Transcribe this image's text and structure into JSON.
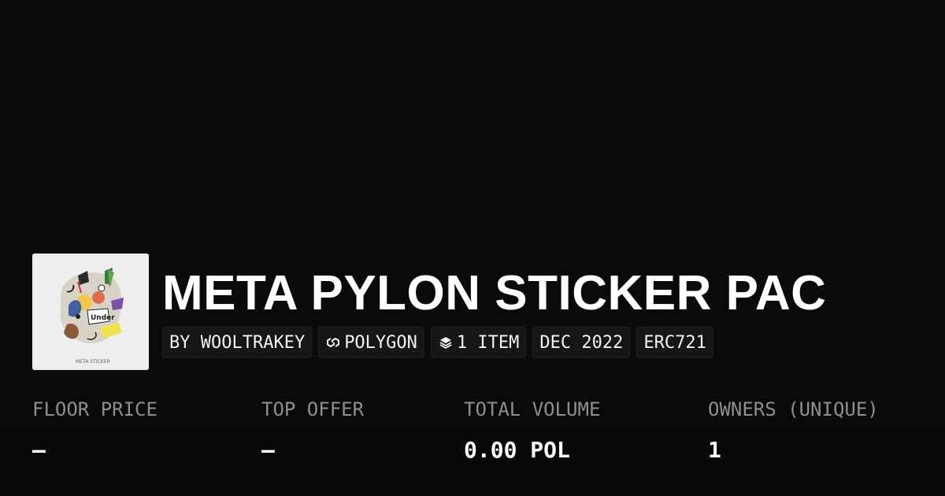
{
  "collection": {
    "title": "META PYLON STICKER PAC",
    "thumbnail_caption": "META STICKER",
    "tags": [
      {
        "label": "BY WOOLTRAKEY",
        "icon": ""
      },
      {
        "label": "POLYGON",
        "icon": "polygon-chain-icon"
      },
      {
        "label": "1 ITEM",
        "icon": "layers-icon"
      },
      {
        "label": "DEC 2022",
        "icon": ""
      },
      {
        "label": "ERC721",
        "icon": ""
      }
    ]
  },
  "stats": [
    {
      "label": "FLOOR PRICE",
      "value": "–"
    },
    {
      "label": "TOP OFFER",
      "value": "–"
    },
    {
      "label": "TOTAL VOLUME",
      "value": "0.00 POL"
    },
    {
      "label": "OWNERS (UNIQUE)",
      "value": "1"
    }
  ],
  "colors": {
    "background": "#0a0a0a",
    "tag_background": "#161616",
    "label_gray": "#8f8f8f",
    "text": "#ffffff"
  }
}
